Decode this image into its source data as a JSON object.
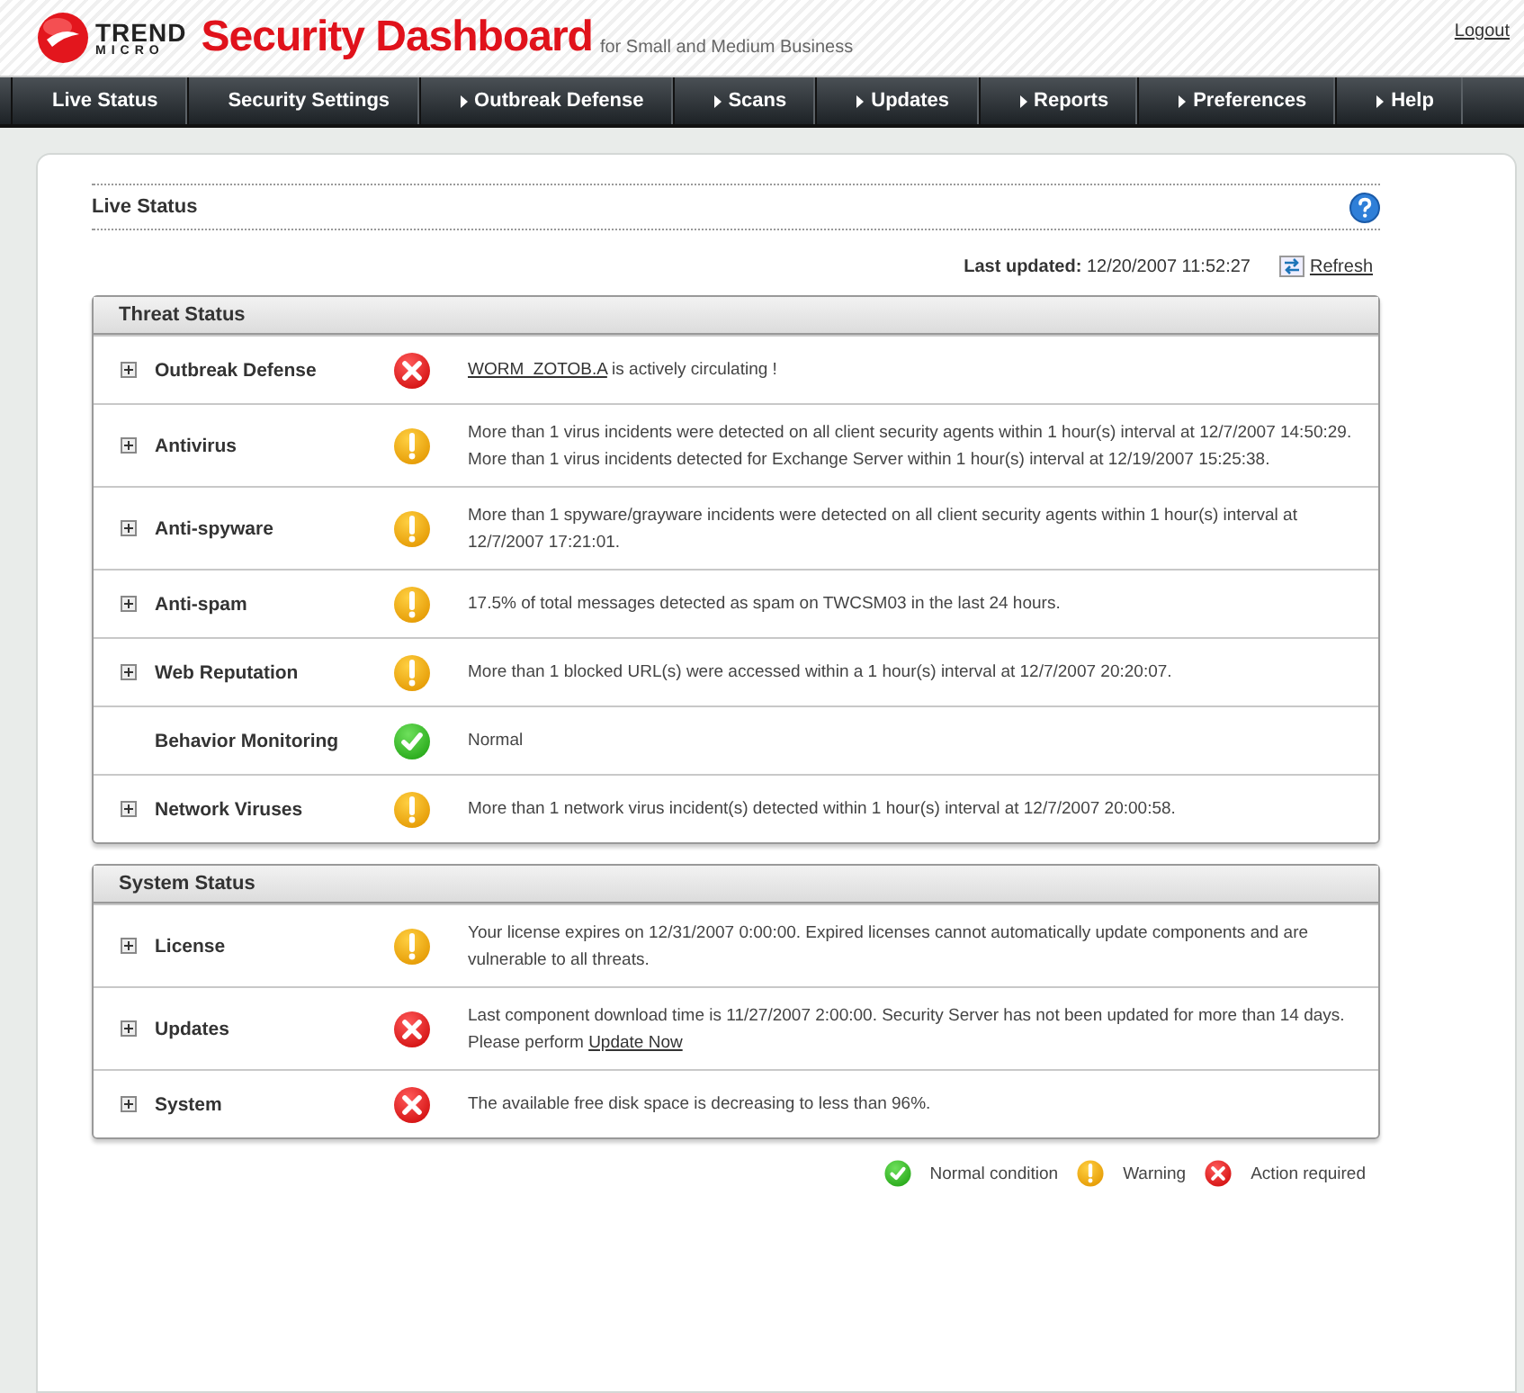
{
  "header": {
    "logo_top": "TREND",
    "logo_bottom": "MICRO",
    "title": "Security Dashboard",
    "subtitle": "for Small and Medium Business",
    "logout": "Logout"
  },
  "nav": [
    {
      "label": "Live Status",
      "arrow": false
    },
    {
      "label": "Security Settings",
      "arrow": false
    },
    {
      "label": "Outbreak Defense",
      "arrow": true
    },
    {
      "label": "Scans",
      "arrow": true
    },
    {
      "label": "Updates",
      "arrow": true
    },
    {
      "label": "Reports",
      "arrow": true
    },
    {
      "label": "Preferences",
      "arrow": true
    },
    {
      "label": "Help",
      "arrow": true
    }
  ],
  "page_title": "Live Status",
  "last_updated": {
    "label": "Last updated:",
    "value": "12/20/2007 11:52:27",
    "refresh": "Refresh"
  },
  "sections": [
    {
      "title": "Threat Status",
      "rows": [
        {
          "name": "Outbreak Defense",
          "expandable": true,
          "kind": "error",
          "lines": [
            [
              {
                "text": "WORM_ZOTOB.A",
                "link": true
              },
              {
                "text": " is actively circulating !",
                "link": false
              }
            ]
          ]
        },
        {
          "name": "Antivirus",
          "expandable": true,
          "kind": "warning",
          "lines": [
            [
              {
                "text": "More than 1 virus incidents were detected on all client security agents within 1 hour(s) interval at 12/7/2007 14:50:29.",
                "link": false
              }
            ],
            [
              {
                "text": "More than 1 virus incidents detected for Exchange Server within 1 hour(s) interval at 12/19/2007 15:25:38.",
                "link": false
              }
            ]
          ]
        },
        {
          "name": "Anti-spyware",
          "expandable": true,
          "kind": "warning",
          "lines": [
            [
              {
                "text": "More than 1 spyware/grayware incidents were detected on all client security agents within 1 hour(s) interval at 12/7/2007 17:21:01.",
                "link": false
              }
            ]
          ]
        },
        {
          "name": "Anti-spam",
          "expandable": true,
          "kind": "warning",
          "lines": [
            [
              {
                "text": "17.5% of total messages detected as spam on TWCSM03 in the last 24 hours.",
                "link": false
              }
            ]
          ]
        },
        {
          "name": "Web Reputation",
          "expandable": true,
          "kind": "warning",
          "lines": [
            [
              {
                "text": "More than 1 blocked URL(s) were accessed within a 1 hour(s) interval at 12/7/2007 20:20:07.",
                "link": false
              }
            ]
          ]
        },
        {
          "name": "Behavior Monitoring",
          "expandable": false,
          "kind": "ok",
          "lines": [
            [
              {
                "text": "Normal",
                "link": false
              }
            ]
          ]
        },
        {
          "name": "Network Viruses",
          "expandable": true,
          "kind": "warning",
          "lines": [
            [
              {
                "text": "More than 1 network virus incident(s) detected within 1 hour(s) interval at 12/7/2007 20:00:58.",
                "link": false
              }
            ]
          ]
        }
      ]
    },
    {
      "title": "System Status",
      "rows": [
        {
          "name": "License",
          "expandable": true,
          "kind": "warning",
          "lines": [
            [
              {
                "text": "Your license expires on 12/31/2007 0:00:00. Expired licenses cannot automatically update components and are vulnerable to all threats.",
                "link": false
              }
            ]
          ]
        },
        {
          "name": "Updates",
          "expandable": true,
          "kind": "error",
          "lines": [
            [
              {
                "text": "Last component download time is 11/27/2007 2:00:00. Security Server has not been updated for more than 14 days.",
                "link": false
              }
            ],
            [
              {
                "text": "Please perform ",
                "link": false
              },
              {
                "text": "Update Now",
                "link": true
              }
            ]
          ]
        },
        {
          "name": "System",
          "expandable": true,
          "kind": "error",
          "lines": [
            [
              {
                "text": "The available free disk space is decreasing to less than 96%.",
                "link": false
              }
            ]
          ]
        }
      ]
    }
  ],
  "legend": [
    {
      "kind": "ok",
      "label": "Normal condition"
    },
    {
      "kind": "warning",
      "label": "Warning"
    },
    {
      "kind": "error",
      "label": "Action required"
    }
  ]
}
